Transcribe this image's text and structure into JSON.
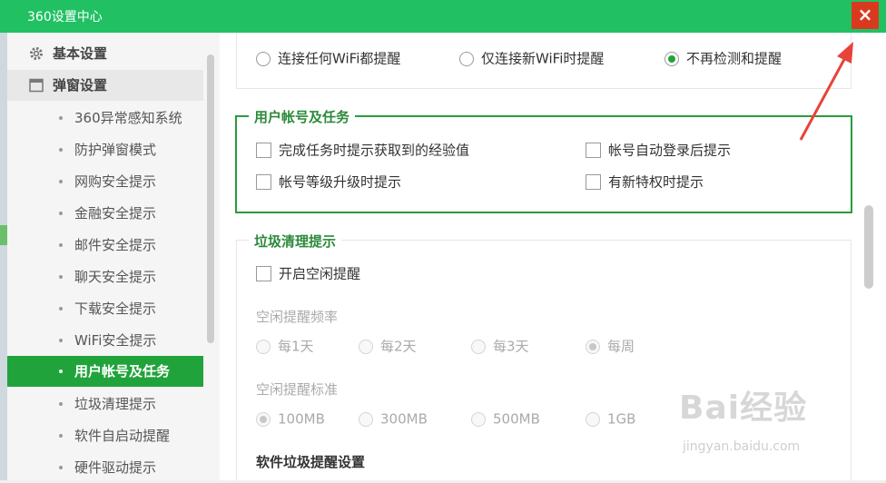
{
  "window": {
    "title": "360设置中心",
    "close_label": "×"
  },
  "sidebar": {
    "items": [
      {
        "label": "基本设置",
        "icon": "gear-icon",
        "level": 1
      },
      {
        "label": "弹窗设置",
        "icon": "window-icon",
        "level": 1
      },
      {
        "label": "360异常感知系统",
        "level": 2
      },
      {
        "label": "防护弹窗模式",
        "level": 2
      },
      {
        "label": "网购安全提示",
        "level": 2
      },
      {
        "label": "金融安全提示",
        "level": 2
      },
      {
        "label": "邮件安全提示",
        "level": 2
      },
      {
        "label": "聊天安全提示",
        "level": 2
      },
      {
        "label": "下载安全提示",
        "level": 2
      },
      {
        "label": "WiFi安全提示",
        "level": 2
      },
      {
        "label": "用户帐号及任务",
        "level": 2,
        "active": true
      },
      {
        "label": "垃圾清理提示",
        "level": 2
      },
      {
        "label": "软件自启动提醒",
        "level": 2
      },
      {
        "label": "硬件驱动提示",
        "level": 2
      }
    ]
  },
  "wifi_options": {
    "any": "连接任何WiFi都提醒",
    "new_only": "仅连接新WiFi时提醒",
    "never": "不再检测和提醒",
    "selected": "never"
  },
  "account_section": {
    "title": "用户帐号及任务",
    "options": {
      "task_exp": "完成任务时提示获取到的经验值",
      "auto_login": "帐号自动登录后提示",
      "level_up": "帐号等级升级时提示",
      "privilege": "有新特权时提示"
    }
  },
  "cleanup_section": {
    "title": "垃圾清理提示",
    "enable_idle": "开启空闲提醒",
    "frequency_label": "空闲提醒频率",
    "frequency": {
      "d1": "每1天",
      "d2": "每2天",
      "d3": "每3天",
      "weekly": "每周",
      "selected": "weekly"
    },
    "standard_label": "空闲提醒标准",
    "standard": {
      "s100": "100MB",
      "s300": "300MB",
      "s500": "500MB",
      "s1g": "1GB",
      "selected": "s100"
    },
    "software_label": "软件垃圾提醒设置"
  },
  "watermark": {
    "text": "Bai经验",
    "url": "jingyan.baidu.com"
  },
  "colors": {
    "titlebar": "#21c163",
    "accent": "#21a33b",
    "close": "#d93a1f",
    "annotation_arrow": "#e8433a"
  }
}
